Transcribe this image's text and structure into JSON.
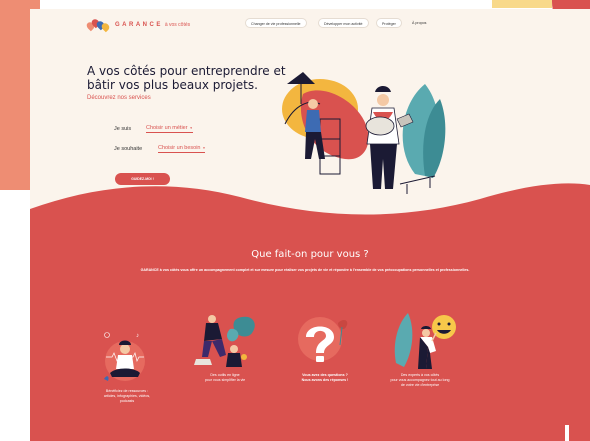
{
  "brand": {
    "name": "GARANCE",
    "tagline": "à vos côtés",
    "colors": {
      "red": "#d9524f",
      "salmon": "#ee8d73",
      "cream": "#fbf4ec",
      "navy": "#1b1a34",
      "yellow": "#f8d98a"
    }
  },
  "nav": {
    "items": [
      "Changer de vie professionnelle",
      "Développer mon activité",
      "Protéger"
    ],
    "link": "À propos"
  },
  "hero": {
    "title": "A vos côtés pour entreprendre et bâtir vos plus beaux projets.",
    "subtitle": "Découvrez nos services",
    "selector1_label": "Je suis",
    "selector1_value": "Choisir un métier",
    "selector2_label": "Je souhaite",
    "selector2_value": "Choisir un besoin",
    "cta": "GUIDEZ-MOI !"
  },
  "services": {
    "title": "Que fait-on pour vous ?",
    "description": "GARANCE à vos côtés vous offre un accompagnement complet et sur mesure pour réaliser vos projets de vie et répondre à l'ensemble de vos préoccupations personnelles et professionnelles.",
    "features": [
      {
        "icon": "meditation-resources-icon",
        "caption_lines": [
          "Bénéficiez de ressources :",
          "articles, infographies, vidéos,",
          "podcasts"
        ]
      },
      {
        "icon": "online-tools-icon",
        "caption_lines": [
          "Des outils en ligne",
          "pour vous simplifier la vie"
        ]
      },
      {
        "icon": "question-mark-icon",
        "caption_lines": [
          "Vous avez des questions ?",
          "Nous avons des réponses !"
        ]
      },
      {
        "icon": "expert-smiley-icon",
        "caption_lines": [
          "Des experts à vos côtés",
          "pour vous accompagnez tout au long",
          "de votre vie d'entreprise"
        ]
      }
    ]
  }
}
